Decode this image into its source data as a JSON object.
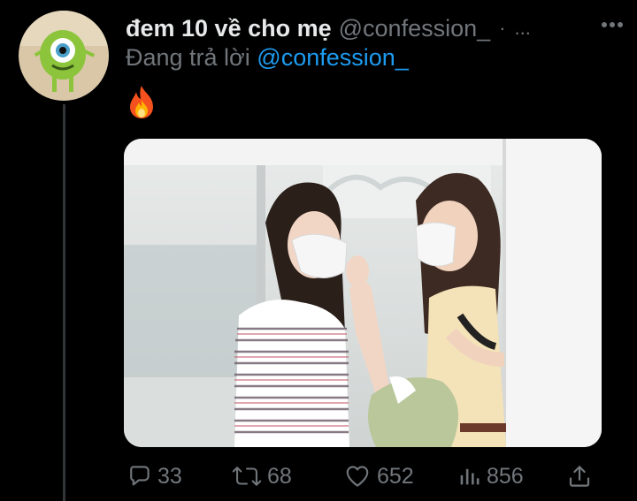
{
  "tweet": {
    "display_name": "đem 10 về cho mẹ",
    "handle": "@confession_",
    "separator": "·",
    "ellipsis": "...",
    "reply_prefix": "Đang trả lời",
    "reply_to": "@confession_",
    "emoji_icon": "fire-emoji",
    "avatar_icon": "mike-wazowski-avatar",
    "media_description_icon": "photo"
  },
  "actions": {
    "reply_count": "33",
    "retweet_count": "68",
    "like_count": "652",
    "views_count": "856"
  },
  "colors": {
    "background": "#000000",
    "text_primary": "#e7e9ea",
    "text_secondary": "#71767b",
    "link": "#1d9bf0"
  }
}
